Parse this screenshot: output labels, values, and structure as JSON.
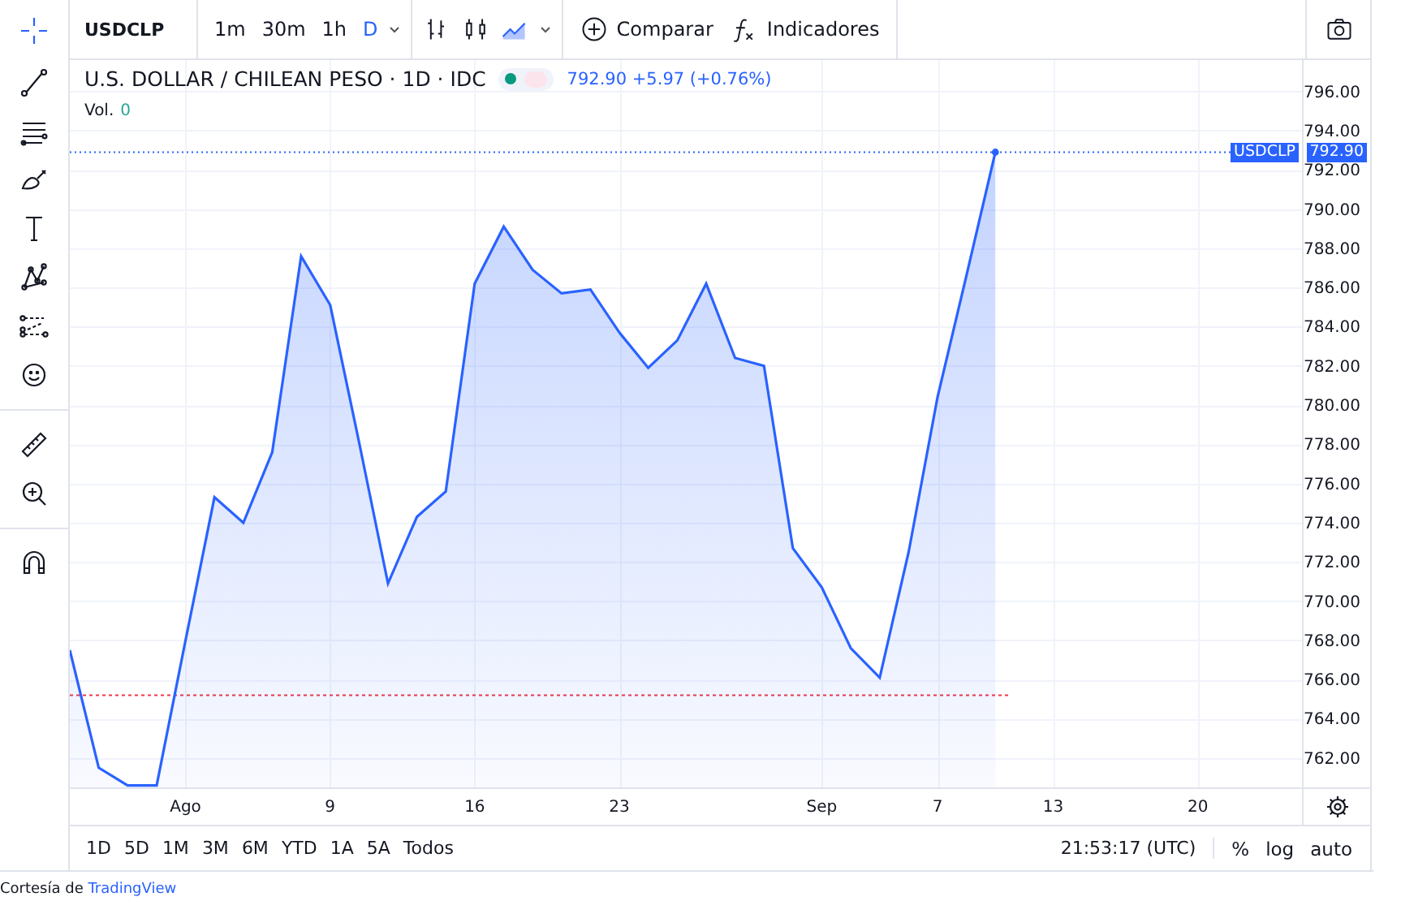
{
  "toolbar": {
    "symbol": "USDCLP",
    "intervals": [
      {
        "label": "1m",
        "selected": false
      },
      {
        "label": "30m",
        "selected": false
      },
      {
        "label": "1h",
        "selected": false
      },
      {
        "label": "D",
        "selected": true
      }
    ],
    "compare": "Comparar",
    "indicators": "Indicadores"
  },
  "legend": {
    "title": "U.S. DOLLAR / CHILEAN PESO · 1D · IDC",
    "quote": "792.90 +5.97 (+0.76%)",
    "volume_label": "Vol.",
    "volume": "0"
  },
  "chart": {
    "price_tag": {
      "symbol": "USDCLP",
      "value": "792.90"
    },
    "chart_data": {
      "type": "area",
      "categories": [
        null,
        null,
        null,
        null,
        "Ago",
        null,
        null,
        null,
        null,
        "9",
        null,
        null,
        null,
        null,
        "16",
        null,
        null,
        null,
        null,
        "23",
        null,
        null,
        null,
        null,
        null,
        null,
        "Sep",
        null,
        null,
        null,
        "7",
        null,
        null,
        null,
        "13",
        null,
        null,
        null,
        null,
        "20"
      ],
      "series": [
        {
          "color": "#2962ff",
          "values": [
            767.5,
            761.5,
            760.6,
            760.6,
            768,
            775.3,
            774,
            777.6,
            787.6,
            785.1,
            778.1,
            770.9,
            774.3,
            775.6,
            786.2,
            789.1,
            786.9,
            785.7,
            785.9,
            783.7,
            781.9,
            783.3,
            786.2,
            782.4,
            782,
            772.7,
            770.7,
            767.6,
            766.1,
            772.5,
            780.4,
            786.6,
            792.9,
            null,
            null,
            null,
            null,
            null,
            null,
            null
          ]
        }
      ],
      "ylim": [
        760.5,
        797.6
      ],
      "yticks": [
        {
          "value": 762,
          "label": "762.00"
        },
        {
          "value": 764,
          "label": "764.00"
        },
        {
          "value": 766,
          "label": "766.00"
        },
        {
          "value": 768,
          "label": "768.00"
        },
        {
          "value": 770,
          "label": "770.00"
        },
        {
          "value": 772,
          "label": "772.00"
        },
        {
          "value": 774,
          "label": "774.00"
        },
        {
          "value": 776,
          "label": "776.00"
        },
        {
          "value": 778,
          "label": "778.00"
        },
        {
          "value": 780,
          "label": "780.00"
        },
        {
          "value": 782,
          "label": "782.00"
        },
        {
          "value": 784,
          "label": "784.00"
        },
        {
          "value": 786,
          "label": "786.00"
        },
        {
          "value": 788,
          "label": "788.00"
        },
        {
          "value": 790,
          "label": "790.00"
        },
        {
          "value": 792,
          "label": "792.00"
        },
        {
          "value": 794,
          "label": "794.00"
        },
        {
          "value": 796,
          "label": "796.00"
        }
      ],
      "grid": true,
      "ref_lines": [
        {
          "axis": "y",
          "value": 765.2,
          "color": "#f23645"
        },
        {
          "axis": "y",
          "value": 792.9,
          "color": "#2962ff"
        }
      ]
    }
  },
  "ranges": [
    {
      "label": "1D",
      "selected": false
    },
    {
      "label": "5D",
      "selected": false
    },
    {
      "label": "1M",
      "selected": false
    },
    {
      "label": "3M",
      "selected": false
    },
    {
      "label": "6M",
      "selected": false
    },
    {
      "label": "YTD",
      "selected": false
    },
    {
      "label": "1A",
      "selected": false
    },
    {
      "label": "5A",
      "selected": false
    },
    {
      "label": "Todos",
      "selected": false
    }
  ],
  "clock": "21:53:17 (UTC)",
  "scale_options": [
    "%",
    "log",
    "auto"
  ],
  "credit": {
    "text": "Cortesía de",
    "link": "TradingView"
  }
}
